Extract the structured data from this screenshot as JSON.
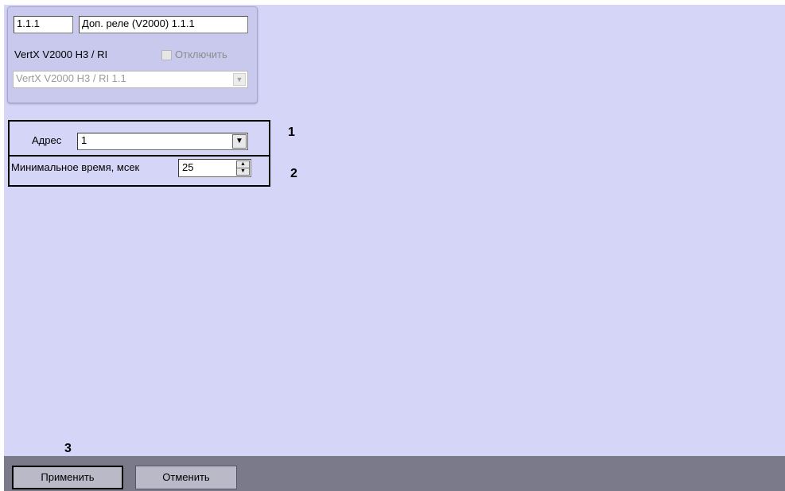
{
  "device": {
    "id": "1.1.1",
    "name": "Доп. реле (V2000) 1.1.1",
    "type_label": "VertX V2000 H3 / RI",
    "disable_label": "Отключить",
    "parent_value": "VertX V2000 H3 / RI 1.1"
  },
  "settings": {
    "address_label": "Адрес",
    "address_value": "1",
    "min_time_label": "Минимальное время, мсек",
    "min_time_value": "25"
  },
  "callouts": {
    "one": "1",
    "two": "2",
    "three": "3"
  },
  "buttons": {
    "apply": "Применить",
    "cancel": "Отменить"
  }
}
